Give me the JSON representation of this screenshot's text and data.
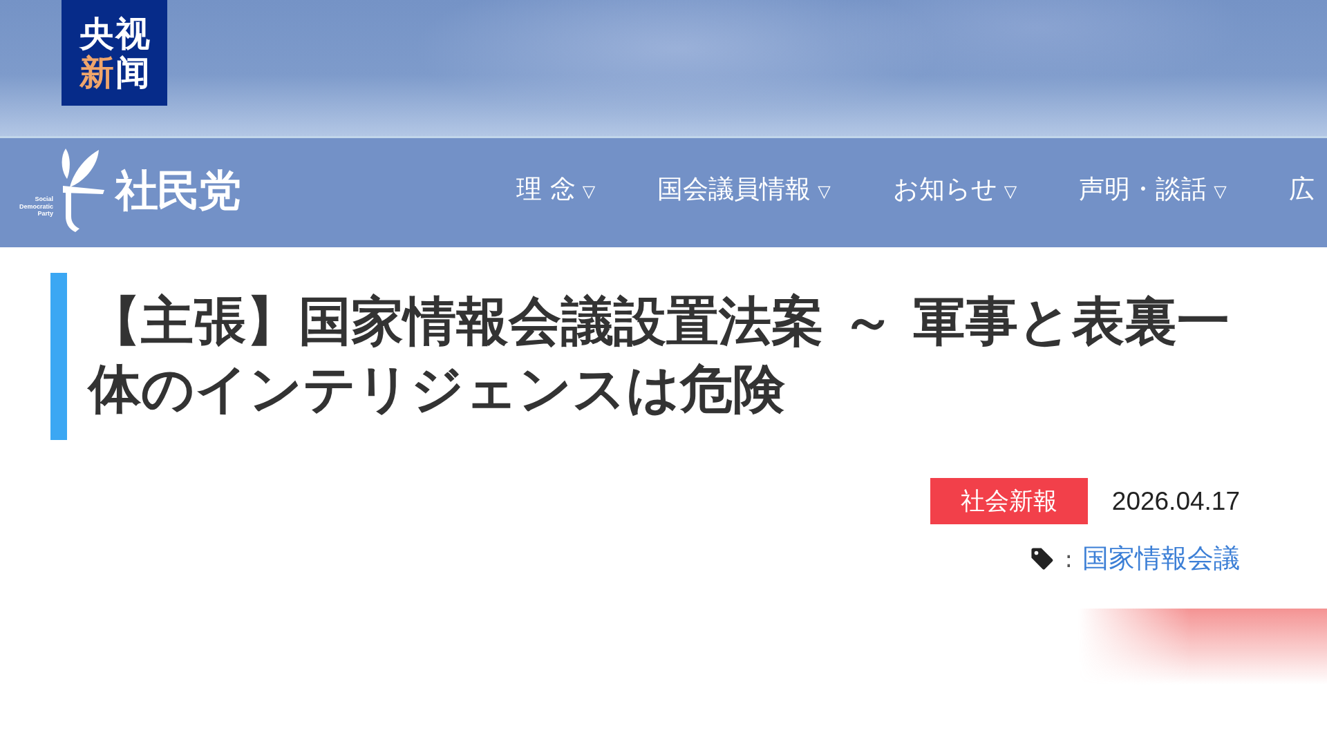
{
  "broadcaster_logo": {
    "chars": [
      {
        "text": "央",
        "color": "#ffffff"
      },
      {
        "text": "视",
        "color": "#ffffff"
      },
      {
        "text": "新",
        "color": "#efa56b"
      },
      {
        "text": "闻",
        "color": "#ffffff"
      }
    ]
  },
  "header": {
    "logo": {
      "name": "社民党",
      "subtitle": "Social Democratic Party"
    },
    "nav": [
      {
        "label": "理 念",
        "caret": "▽"
      },
      {
        "label": "国会議員情報",
        "caret": "▽"
      },
      {
        "label": "お知らせ",
        "caret": "▽"
      },
      {
        "label": "声明・談話",
        "caret": "▽"
      },
      {
        "label": "広"
      }
    ]
  },
  "article": {
    "title": "【主張】国家情報会議設置法案 ～ 軍事と表裏一体のインテリジェンスは危険",
    "category": "社会新報",
    "date": "2026.04.17",
    "tags": {
      "separator": ":",
      "items": [
        "国家情報会議"
      ]
    }
  }
}
